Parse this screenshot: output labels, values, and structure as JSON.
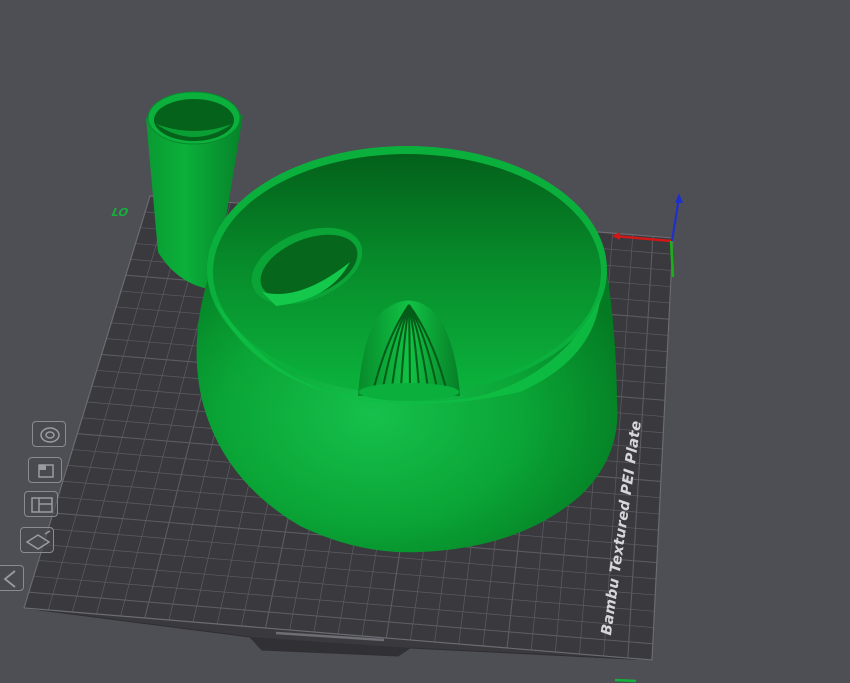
{
  "viewport": {
    "background": "#4e4e55",
    "plate": {
      "name": "Bambu Textured PEI Plate",
      "number_label": "LO",
      "plate_color": "#39393e",
      "grid_color": "#5c5c63"
    },
    "model": {
      "color": "#0aa336"
    },
    "axes": {
      "x_color": "#d01818",
      "y_color": "#19b019",
      "z_color": "#1f2fcc"
    },
    "side_toolbar": [
      {
        "icon": "top-view-icon"
      },
      {
        "icon": "front-view-icon"
      },
      {
        "icon": "side-view-icon"
      },
      {
        "icon": "iso-view-icon"
      },
      {
        "icon": "collapse-icon"
      }
    ]
  }
}
